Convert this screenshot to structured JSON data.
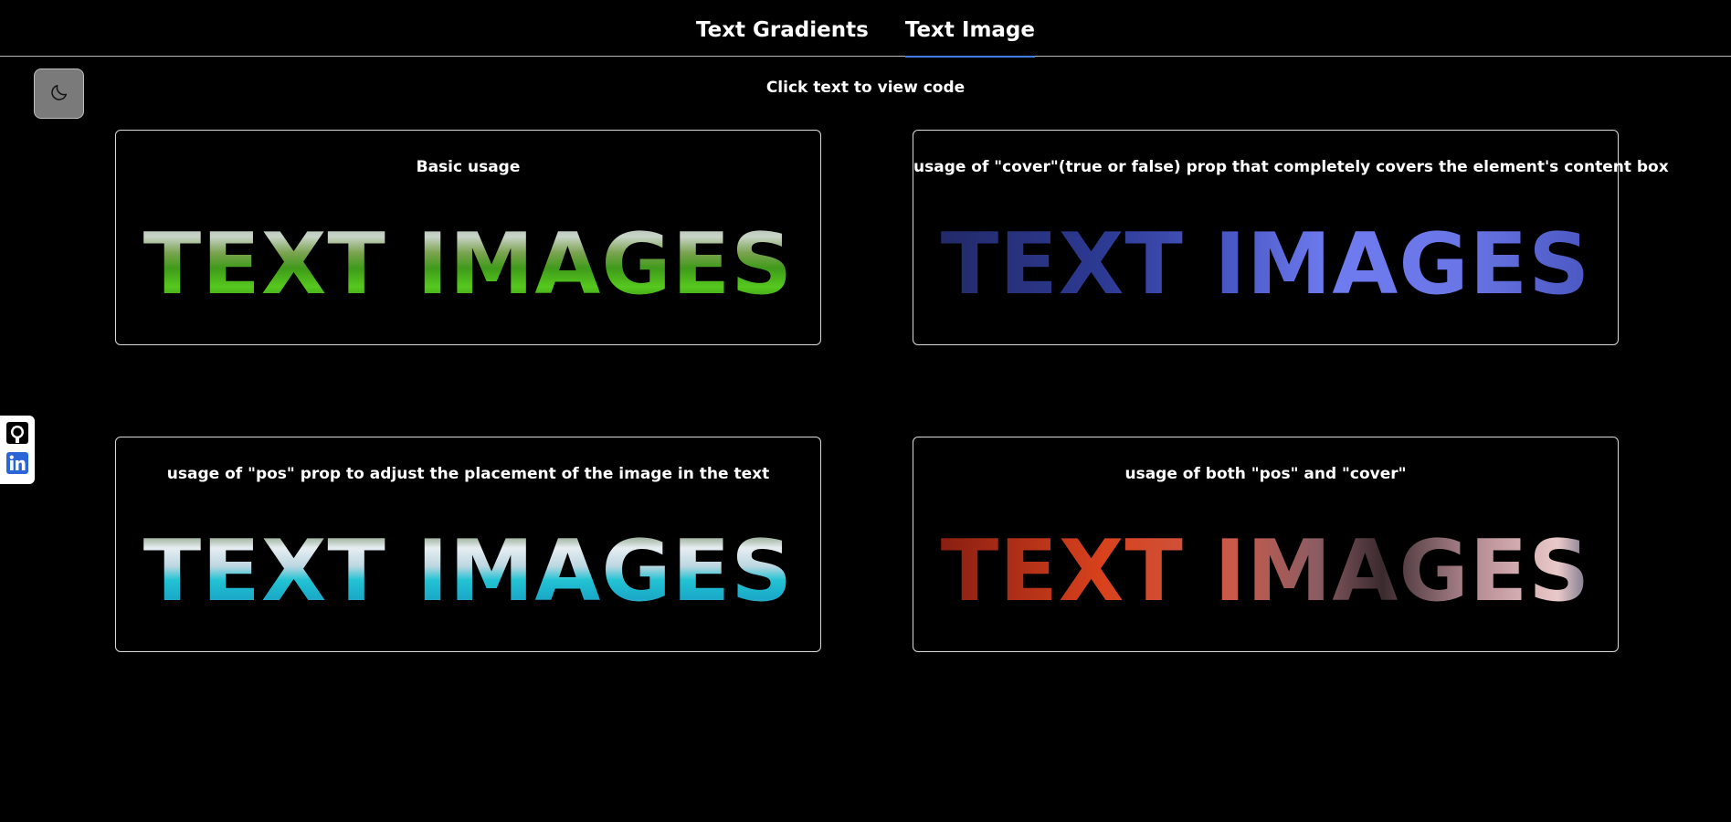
{
  "nav": {
    "tabs": [
      {
        "label": "Text Gradients",
        "active": false
      },
      {
        "label": "Text Image",
        "active": true
      }
    ]
  },
  "theme_toggle": {
    "icon": "moon-icon"
  },
  "hint": "Click text to view code",
  "social": {
    "github_icon": "github-icon",
    "linkedin_icon": "linkedin-icon"
  },
  "cards": [
    {
      "title": "Basic usage",
      "art_text": "TEXT IMAGES"
    },
    {
      "title": "usage of \"cover\"(true or false) prop that completely covers the element's content box",
      "art_text": "TEXT IMAGES"
    },
    {
      "title": "usage of \"pos\" prop to adjust the placement of the image in the text",
      "art_text": "TEXT IMAGES"
    },
    {
      "title": "usage of both \"pos\" and \"cover\"",
      "art_text": "TEXT IMAGES"
    }
  ],
  "colors": {
    "background": "#000000",
    "active_tab_underline": "#3d7ee6",
    "toggle_bg": "#7a7a7a"
  }
}
